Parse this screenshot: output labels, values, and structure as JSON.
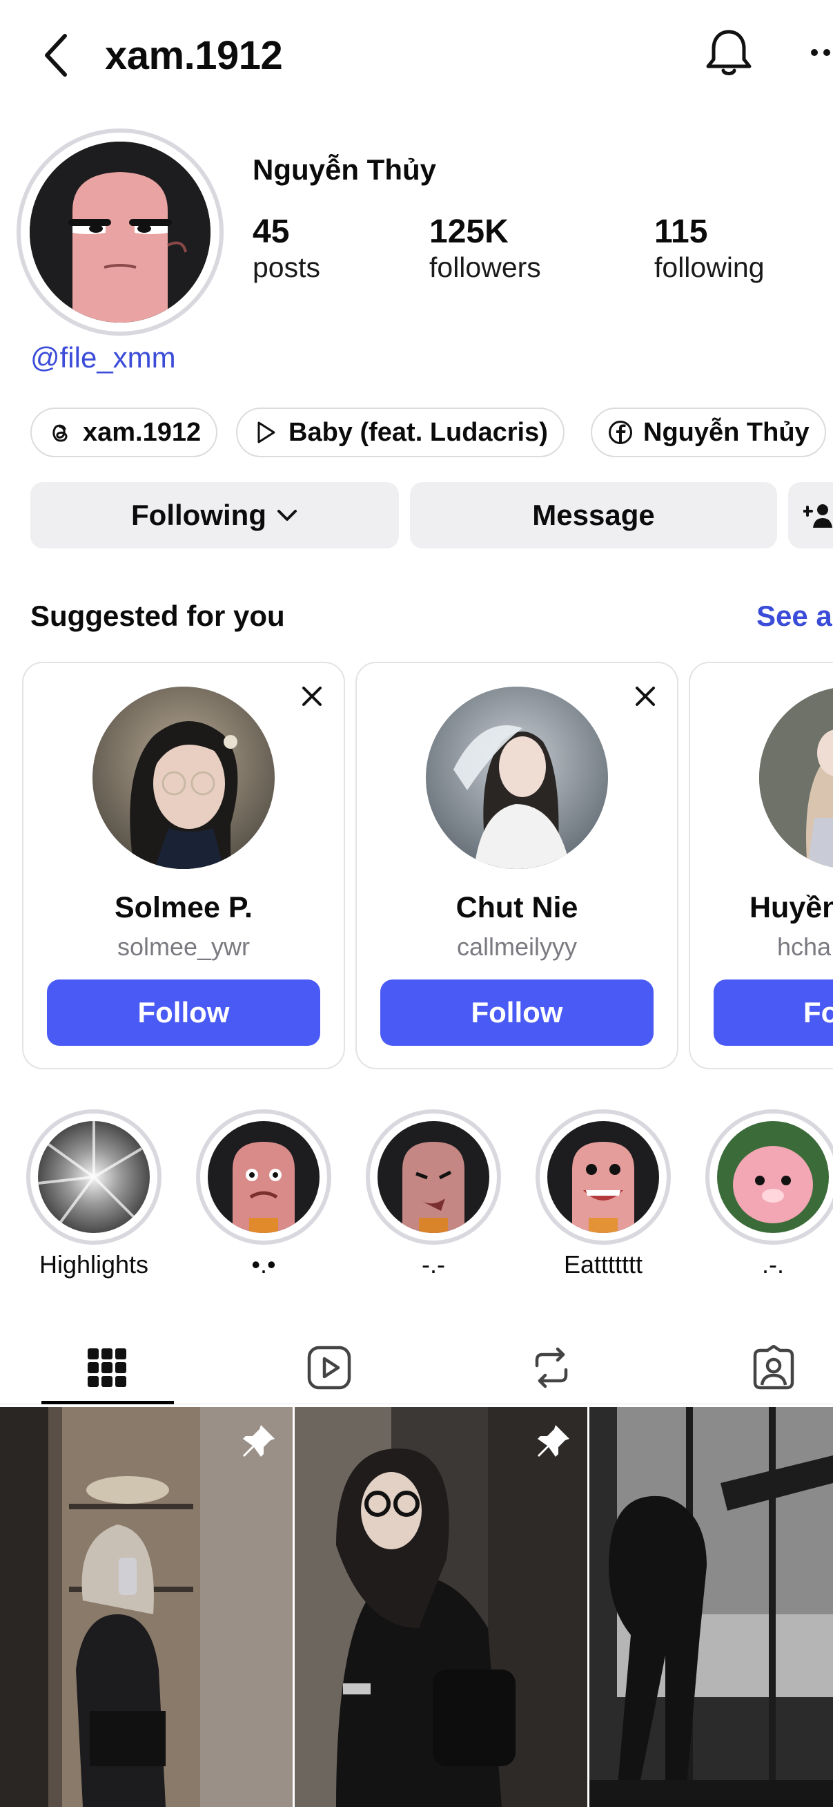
{
  "header": {
    "username": "xam.1912",
    "back_icon": "chevron-left-icon",
    "bell_icon": "bell-icon",
    "more_icon": "more-horizontal-icon"
  },
  "profile": {
    "display_name": "Nguyễn Thủy",
    "stats": [
      {
        "value": "45",
        "label": "posts"
      },
      {
        "value": "125K",
        "label": "followers"
      },
      {
        "value": "115",
        "label": "following"
      }
    ],
    "link": "@file_xmm",
    "chips": [
      {
        "icon": "threads-icon",
        "label": "xam.1912"
      },
      {
        "icon": "play-icon",
        "label": "Baby (feat. Ludacris)"
      },
      {
        "icon": "facebook-icon",
        "label": "Nguyễn Thủy"
      }
    ]
  },
  "actions": {
    "following_label": "Following",
    "message_label": "Message",
    "add_user_icon": "add-user-icon"
  },
  "suggested": {
    "title": "Suggested for you",
    "see_all": "See all",
    "cards": [
      {
        "name": "Solmee P.",
        "username": "solmee_ywr",
        "button": "Follow"
      },
      {
        "name": "Chut Nie",
        "username": "callmeilyyy",
        "button": "Follow"
      },
      {
        "name": "Huyền",
        "username": "hcha",
        "button": "Follow"
      }
    ]
  },
  "highlights": [
    {
      "label": "Highlights"
    },
    {
      "label": "•.•"
    },
    {
      "label": "-.-"
    },
    {
      "label": "Eattttttt"
    },
    {
      "label": ".-."
    }
  ],
  "tabs": [
    {
      "icon": "grid-icon",
      "active": true
    },
    {
      "icon": "reels-icon",
      "active": false
    },
    {
      "icon": "repost-icon",
      "active": false
    },
    {
      "icon": "tagged-icon",
      "active": false
    }
  ],
  "posts": [
    {
      "pinned": true
    },
    {
      "pinned": true
    },
    {
      "pinned": false
    }
  ],
  "colors": {
    "accent": "#4a5af5",
    "link": "#3b4cd8",
    "button_bg": "#efeff2"
  }
}
